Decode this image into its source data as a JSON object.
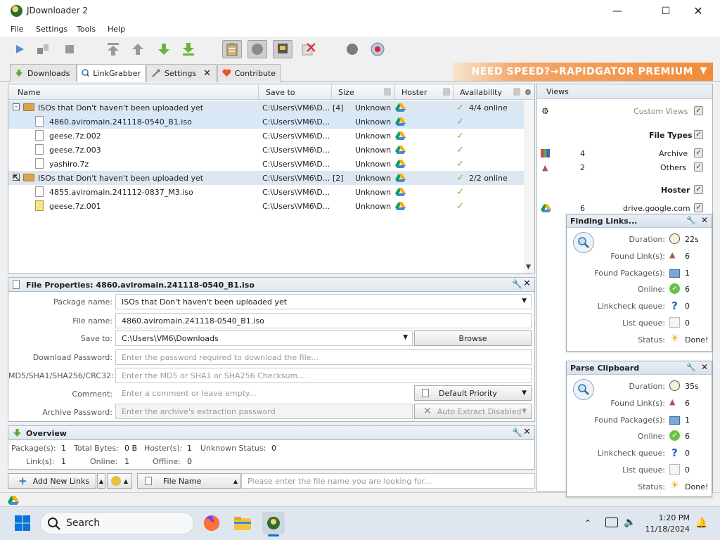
{
  "window": {
    "title": "JDownloader 2"
  },
  "menu": [
    "File",
    "Settings",
    "Tools",
    "Help"
  ],
  "tabs": [
    {
      "label": "Downloads"
    },
    {
      "label": "LinkGrabber"
    },
    {
      "label": "Settings"
    },
    {
      "label": "Contribute"
    }
  ],
  "banner": {
    "text": "NEED SPEED?→RAPIDGATOR PREMIUM"
  },
  "columns": {
    "name": "Name",
    "save_to": "Save to",
    "size": "Size",
    "hoster": "Hoster",
    "availability": "Availability"
  },
  "rows": [
    {
      "kind": "package",
      "name": "ISOs that Don't haven't been uploaded yet",
      "save_to": "C:\\Users\\VM6\\D...",
      "count": "[4]",
      "size": "Unknown",
      "availability": "4/4 online"
    },
    {
      "kind": "file",
      "name": "4860.aviromain.241118-0540_B1.iso",
      "save_to": "C:\\Users\\VM6\\D...",
      "size": "Unknown"
    },
    {
      "kind": "file",
      "name": "geese.7z.002",
      "save_to": "C:\\Users\\VM6\\D...",
      "size": "Unknown"
    },
    {
      "kind": "file",
      "name": "geese.7z.003",
      "save_to": "C:\\Users\\VM6\\D...",
      "size": "Unknown"
    },
    {
      "kind": "file",
      "name": "yashiro.7z",
      "save_to": "C:\\Users\\VM6\\D...",
      "size": "Unknown"
    },
    {
      "kind": "package",
      "name": "ISOs that Don't haven't been uploaded yet",
      "save_to": "C:\\Users\\VM6\\D...",
      "count": "[2]",
      "size": "Unknown",
      "availability": "2/2 online"
    },
    {
      "kind": "file",
      "name": "4855.aviromain.241112-0837_M3.iso",
      "save_to": "C:\\Users\\VM6\\D...",
      "size": "Unknown"
    },
    {
      "kind": "file",
      "name": "geese.7z.001",
      "save_to": "C:\\Users\\VM6\\D...",
      "size": "Unknown"
    }
  ],
  "properties": {
    "title": "File Properties: 4860.aviromain.241118-0540_B1.iso",
    "package_label": "Package name:",
    "package_value": "ISOs that Don't haven't been uploaded yet",
    "filename_label": "File name:",
    "filename_value": "4860.aviromain.241118-0540_B1.iso",
    "saveto_label": "Save to:",
    "saveto_value": "C:\\Users\\VM6\\Downloads",
    "browse": "Browse",
    "password_label": "Download Password:",
    "password_placeholder": "Enter the password required to download the file...",
    "checksum_label": "MD5/SHA1/SHA256/CRC32:",
    "checksum_placeholder": "Enter the MD5 or SHA1 or SHA256 Checksum...",
    "comment_label": "Comment:",
    "comment_placeholder": "Enter a comment or leave empty...",
    "priority": "Default Priority",
    "archive_label": "Archive Password:",
    "archive_placeholder": "Enter the archive's extraction password",
    "auto_extract": "Auto Extract Disabled"
  },
  "overview": {
    "title": "Overview",
    "packages_label": "Package(s):",
    "packages": "1",
    "bytes_label": "Total Bytes:",
    "bytes": "0 B",
    "hosters_label": "Hoster(s):",
    "hosters": "1",
    "unknown_label": "Unknown Status:",
    "unknown": "0",
    "links_label": "Link(s):",
    "links": "1",
    "online_label": "Online:",
    "online": "1",
    "offline_label": "Offline:",
    "offline": "0"
  },
  "bottom": {
    "add_links": "Add New Links",
    "filter_field": "File Name",
    "search_placeholder": "Please enter the file name you are looking for..."
  },
  "sidebar": {
    "title": "Views",
    "custom_views": "Custom Views",
    "file_types": "File Types",
    "archive_count": "4",
    "archive": "Archive",
    "others_count": "2",
    "others": "Others",
    "hoster": "Hoster",
    "hoster_count": "6",
    "hoster_name": "drive.google.com"
  },
  "finding_links": {
    "title": "Finding Links...",
    "duration_label": "Duration:",
    "duration": "22s",
    "found_links_label": "Found Link(s):",
    "found_links": "6",
    "found_packages_label": "Found Package(s):",
    "found_packages": "1",
    "online_label": "Online:",
    "online": "6",
    "queue_label": "Linkcheck queue:",
    "queue": "0",
    "list_label": "List queue:",
    "list": "0",
    "status_label": "Status:",
    "status": "Done!"
  },
  "parse_clipboard": {
    "title": "Parse Clipboard",
    "duration_label": "Duration:",
    "duration": "35s",
    "found_links_label": "Found Link(s):",
    "found_links": "6",
    "found_packages_label": "Found Package(s):",
    "found_packages": "1",
    "online_label": "Online:",
    "online": "6",
    "queue_label": "Linkcheck queue:",
    "queue": "0",
    "list_label": "List queue:",
    "list": "0",
    "status_label": "Status:",
    "status": "Done!"
  },
  "taskbar": {
    "search": "Search",
    "time": "1:20 PM",
    "date": "11/18/2024"
  },
  "colors": {
    "accent": "#2a7ab8",
    "banner": "#f08c3a",
    "check": "#79b443",
    "selection": "#d7e8f7"
  }
}
